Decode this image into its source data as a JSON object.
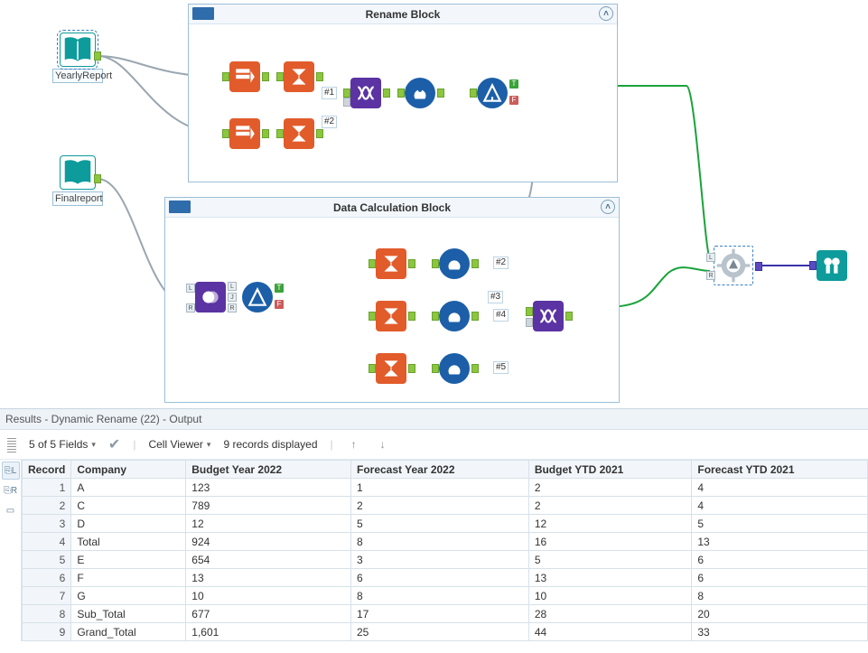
{
  "canvas": {
    "inputs": {
      "yearly": {
        "label": "YearlyReport"
      },
      "final": {
        "label": "Finalreport"
      }
    },
    "blocks": {
      "rename": {
        "title": "Rename Block"
      },
      "calc": {
        "title": "Data Calculation Block"
      }
    },
    "annotations": {
      "rb_n1": "#1",
      "rb_n2": "#2",
      "cb_n2": "#2",
      "cb_n3": "#3",
      "cb_n4": "#4",
      "cb_n5": "#5"
    },
    "anchors": {
      "t": "T",
      "f": "F",
      "l": "L",
      "j": "J",
      "r": "R"
    }
  },
  "results": {
    "title": "Results - Dynamic Rename (22) - Output",
    "fields_text": "5 of 5 Fields",
    "cell_viewer": "Cell Viewer",
    "records_text": "9 records displayed",
    "columns": [
      "Record",
      "Company",
      "Budget Year 2022",
      "Forecast Year 2022",
      "Budget YTD 2021",
      "Forecast YTD 2021"
    ],
    "rows": [
      [
        "1",
        "A",
        "123",
        "1",
        "2",
        "4"
      ],
      [
        "2",
        "C",
        "789",
        "2",
        "2",
        "4"
      ],
      [
        "3",
        "D",
        "12",
        "5",
        "12",
        "5"
      ],
      [
        "4",
        "Total",
        "924",
        "8",
        "16",
        "13"
      ],
      [
        "5",
        "E",
        "654",
        "3",
        "5",
        "6"
      ],
      [
        "6",
        "F",
        "13",
        "6",
        "13",
        "6"
      ],
      [
        "7",
        "G",
        "10",
        "8",
        "10",
        "8"
      ],
      [
        "8",
        "Sub_Total",
        "677",
        "17",
        "28",
        "20"
      ],
      [
        "9",
        "Grand_Total",
        "1,601",
        "25",
        "44",
        "33"
      ]
    ]
  },
  "colors": {
    "orange": "#e25b2b",
    "blue": "#1c5fa8",
    "purple": "#5b33a3",
    "teal": "#0d9b9b",
    "green_true": "#3aa33a",
    "red_false": "#cc5b5b"
  }
}
